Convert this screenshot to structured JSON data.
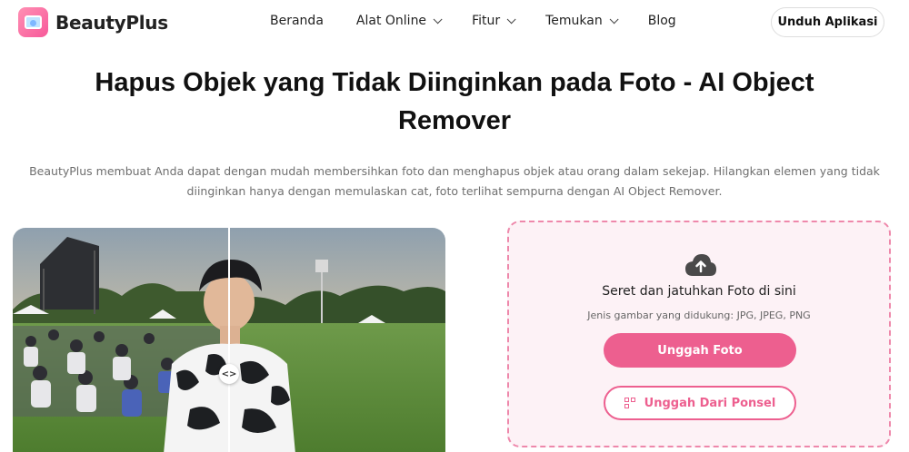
{
  "brand": {
    "name": "BeautyPlus",
    "logo_icon": "beautyplus-logo-icon"
  },
  "nav": {
    "items": [
      {
        "label": "Beranda",
        "dropdown": false
      },
      {
        "label": "Alat Online",
        "dropdown": true
      },
      {
        "label": "Fitur",
        "dropdown": true
      },
      {
        "label": "Temukan",
        "dropdown": true
      },
      {
        "label": "Blog",
        "dropdown": false
      }
    ],
    "download_label": "Unduh Aplikasi"
  },
  "hero": {
    "title": "Hapus Objek yang Tidak Diinginkan pada Foto - AI Object Remover",
    "subtitle": "BeautyPlus membuat Anda dapat dengan mudah membersihkan foto dan menghapus objek atau orang dalam sekejap. Hilangkan elemen yang tidak diinginkan hanya dengan memulaskan cat, foto terlihat sempurna dengan AI Object Remover."
  },
  "comparison": {
    "handle_glyph": "<>",
    "slider_position": 0.5
  },
  "upload": {
    "icon": "cloud-upload-icon",
    "drop_title": "Seret dan jatuhkan Foto di sini",
    "supported_types": "Jenis gambar yang didukung: JPG, JPEG, PNG",
    "upload_button": "Unggah Foto",
    "phone_button": "Unggah Dari Ponsel",
    "phone_icon": "qr-code-icon"
  },
  "colors": {
    "accent": "#ed5f8f",
    "dropzone_bg": "#fdf2f6",
    "dropzone_border": "#ee88ab"
  }
}
